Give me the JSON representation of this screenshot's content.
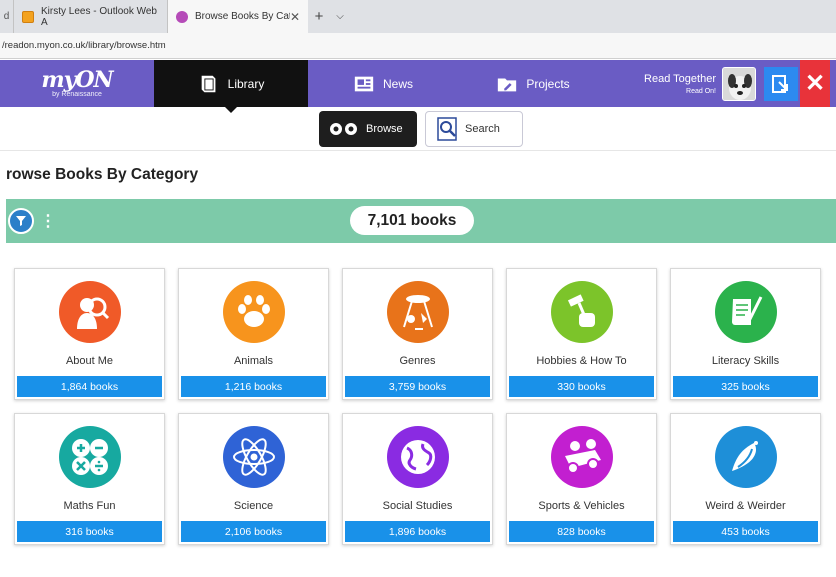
{
  "browser": {
    "tabs": [
      {
        "label": "Kirsty Lees - Outlook Web A",
        "active": false
      },
      {
        "label": "Browse Books By Categ",
        "active": true
      }
    ],
    "left_stub": "d",
    "url": "/readon.myon.co.uk/library/browse.htm"
  },
  "nav": {
    "brand": "myON",
    "brand_sub": "by Renaissance",
    "library": "Library",
    "news": "News",
    "projects": "Projects",
    "read_together": "Read Together",
    "read_on": "Read On!"
  },
  "subtabs": {
    "browse": "Browse",
    "search": "Search"
  },
  "page": {
    "heading": "rowse Books By Category",
    "book_count": "7,101 books"
  },
  "categories": [
    {
      "name": "About Me",
      "count": "1,864 books",
      "color": "#f05a28"
    },
    {
      "name": "Animals",
      "count": "1,216 books",
      "color": "#f7941d"
    },
    {
      "name": "Genres",
      "count": "3,759 books",
      "color": "#e8731a"
    },
    {
      "name": "Hobbies & How To",
      "count": "330 books",
      "color": "#7cc42a"
    },
    {
      "name": "Literacy Skills",
      "count": "325 books",
      "color": "#2bb24c"
    },
    {
      "name": "Maths Fun",
      "count": "316 books",
      "color": "#17a9a0"
    },
    {
      "name": "Science",
      "count": "2,106 books",
      "color": "#2f63d6"
    },
    {
      "name": "Social Studies",
      "count": "1,896 books",
      "color": "#8a2be2"
    },
    {
      "name": "Sports & Vehicles",
      "count": "828 books",
      "color": "#c21fd0"
    },
    {
      "name": "Weird & Weirder",
      "count": "453 books",
      "color": "#1e8fd8"
    }
  ]
}
